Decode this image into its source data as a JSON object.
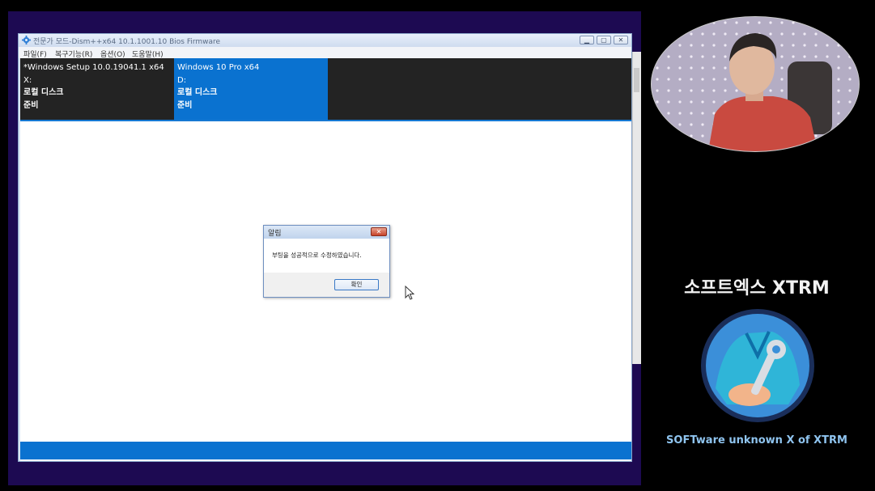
{
  "window": {
    "title": "전문가 모드-Dism++x64 10.1.1001.10 Bios Firmware",
    "menu": [
      "파일(F)",
      "복구기능(R)",
      "옵션(O)",
      "도움말(H)"
    ]
  },
  "sessions": [
    {
      "name": "*Windows Setup 10.0.19041.1 x64",
      "drive": "X:",
      "type": "로컬 디스크",
      "status": "준비"
    },
    {
      "name": "Windows 10 Pro x64",
      "drive": "D:",
      "type": "로컬 디스크",
      "status": "준비"
    }
  ],
  "dialog": {
    "title": "알림",
    "message": "부팅을 성공적으로 수정하였습니다.",
    "ok_label": "확인",
    "close_glyph": "✕"
  },
  "brand": {
    "title": "소프트엑스 XTRM",
    "tagline": "SOFTware unknown X of XTRM"
  },
  "colors": {
    "accent": "#0a72d0",
    "desktop": "#1d0a52",
    "session_bar": "#232323"
  }
}
